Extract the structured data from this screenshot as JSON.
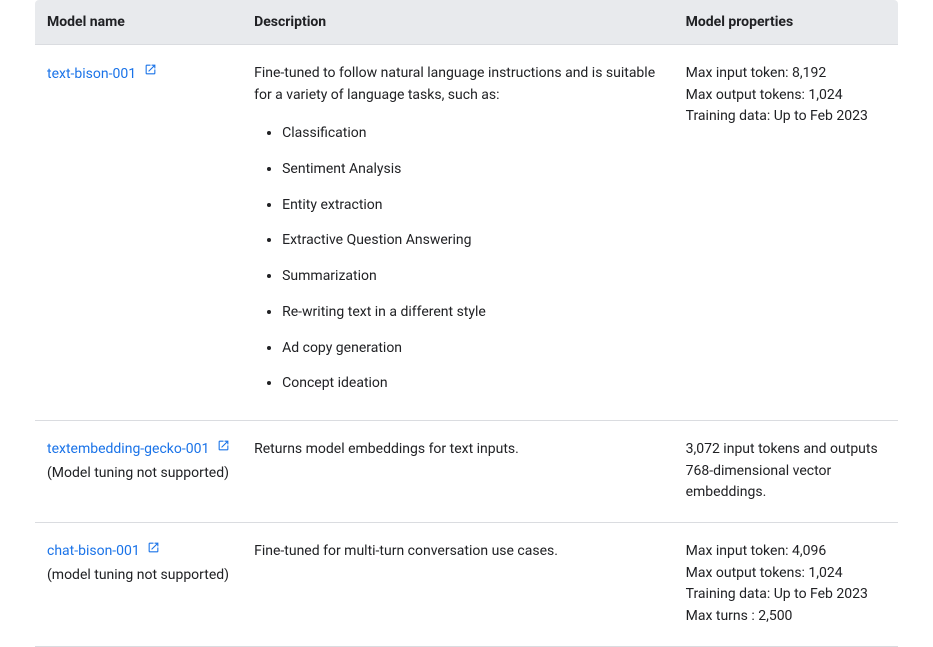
{
  "table": {
    "headers": {
      "name": "Model name",
      "description": "Description",
      "properties": "Model properties"
    },
    "rows": [
      {
        "name": "text-bison-001",
        "subtext": "",
        "description_intro": "Fine-tuned to follow natural language instructions and is suitable for a variety of language tasks, such as:",
        "description_items": [
          "Classification",
          "Sentiment Analysis",
          "Entity extraction",
          "Extractive Question Answering",
          "Summarization",
          "Re-writing text in a different style",
          "Ad copy generation",
          "Concept ideation"
        ],
        "properties": [
          "Max input token: 8,192",
          "Max output tokens: 1,024",
          "Training data: Up to Feb 2023"
        ]
      },
      {
        "name": "textembedding-gecko-001",
        "subtext": "(Model tuning not supported)",
        "description_intro": "Returns model embeddings for text inputs.",
        "description_items": [],
        "properties": [
          "3,072 input tokens and outputs 768-dimensional vector embeddings."
        ]
      },
      {
        "name": "chat-bison-001",
        "subtext": "(model tuning not supported)",
        "description_intro": "Fine-tuned for multi-turn conversation use cases.",
        "description_items": [],
        "properties": [
          "Max input token: 4,096",
          "Max output tokens: 1,024",
          "Training data: Up to Feb 2023",
          "Max turns : 2,500"
        ]
      }
    ]
  }
}
